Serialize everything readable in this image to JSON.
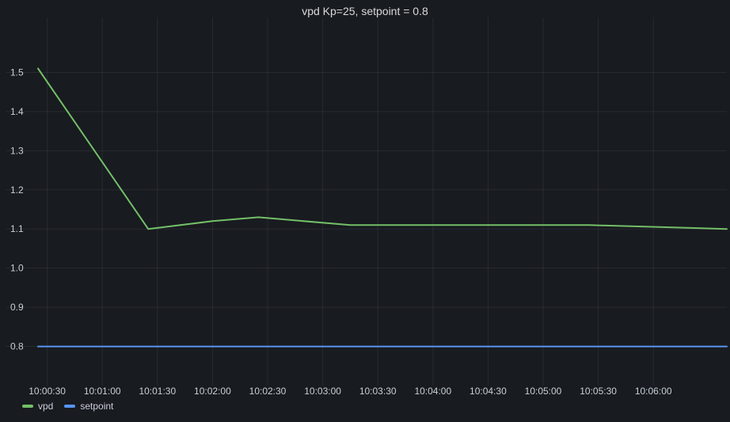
{
  "panel": {
    "title": "vpd Kp=25, setpoint = 0.8"
  },
  "legend": {
    "items": [
      {
        "label": "vpd",
        "color": "#73bf69"
      },
      {
        "label": "setpoint",
        "color": "#5794f2"
      }
    ]
  },
  "chart_data": {
    "type": "line",
    "title": "vpd Kp=25, setpoint = 0.8",
    "xlabel": "",
    "ylabel": "",
    "x_ticks": [
      "10:00:30",
      "10:01:00",
      "10:01:30",
      "10:02:00",
      "10:02:30",
      "10:03:00",
      "10:03:30",
      "10:04:00",
      "10:04:30",
      "10:05:00",
      "10:05:30",
      "10:06:00"
    ],
    "y_ticks": [
      "0.8",
      "0.9",
      "1.0",
      "1.1",
      "1.2",
      "1.3",
      "1.4",
      "1.5"
    ],
    "xlim": [
      "10:00:25",
      "10:06:40"
    ],
    "ylim": [
      0.7,
      1.6
    ],
    "grid": true,
    "legend_position": "bottom-left",
    "series": [
      {
        "name": "vpd",
        "color": "#73bf69",
        "x": [
          "10:00:25",
          "10:01:25",
          "10:02:00",
          "10:02:25",
          "10:03:15",
          "10:05:25",
          "10:06:40"
        ],
        "y": [
          1.51,
          1.1,
          1.12,
          1.13,
          1.11,
          1.11,
          1.1
        ]
      },
      {
        "name": "setpoint",
        "color": "#5794f2",
        "x": [
          "10:00:25",
          "10:06:40"
        ],
        "y": [
          0.8,
          0.8
        ]
      }
    ]
  }
}
